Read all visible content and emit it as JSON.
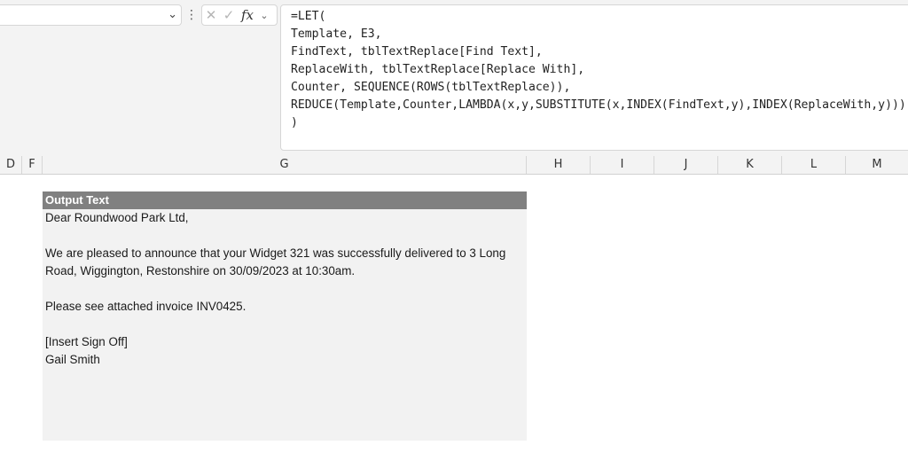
{
  "name_box": {
    "value": ""
  },
  "formula_bar": {
    "cancel_icon": "x-icon",
    "enter_icon": "check-icon",
    "fx_label": "fx",
    "lines": [
      "=LET(",
      "Template, E3,",
      "FindText, tblTextReplace[Find Text],",
      "ReplaceWith, tblTextReplace[Replace With],",
      "Counter, SEQUENCE(ROWS(tblTextReplace)),",
      "REDUCE(Template,Counter,LAMBDA(x,y,SUBSTITUTE(x,INDEX(FindText,y),INDEX(ReplaceWith,y))))",
      ")"
    ]
  },
  "columns": [
    "D",
    "F",
    "G",
    "H",
    "I",
    "J",
    "K",
    "L",
    "M"
  ],
  "output_cell": {
    "header": "Output Text",
    "lines": [
      "Dear Roundwood Park Ltd,",
      "",
      "We are pleased to announce that your Widget 321 was successfully delivered to 3 Long",
      "Road, Wiggington, Restonshire on 30/09/2023 at 10:30am.",
      "",
      "Please see attached invoice INV0425.",
      "",
      "[Insert Sign Off]",
      "Gail Smith"
    ]
  },
  "colors": {
    "header_fill": "#808080",
    "cell_fill": "#f2f2f2",
    "ui_background": "#f3f3f3"
  }
}
